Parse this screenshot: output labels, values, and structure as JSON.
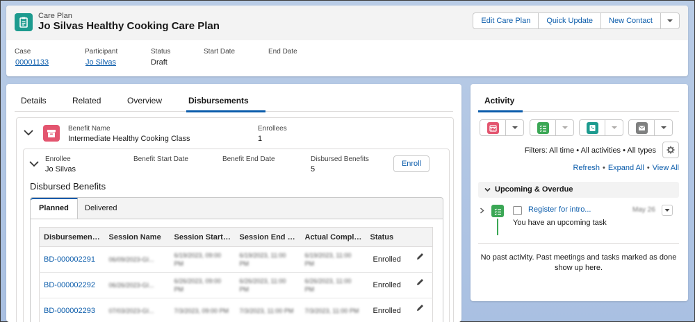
{
  "header": {
    "object_type": "Care Plan",
    "title": "Jo Silvas Healthy Cooking Care Plan",
    "buttons": [
      "Edit Care Plan",
      "Quick Update",
      "New Contact"
    ],
    "fields": [
      {
        "label": "Case",
        "value": "00001133"
      },
      {
        "label": "Participant",
        "value": "Jo Silvas"
      },
      {
        "label": "Status",
        "value": "Draft"
      },
      {
        "label": "Start Date",
        "value": ""
      },
      {
        "label": "End Date",
        "value": ""
      }
    ]
  },
  "main": {
    "tabs": [
      "Details",
      "Related",
      "Overview",
      "Disbursements"
    ],
    "active_tab": "Disbursements",
    "benefit": {
      "name_label": "Benefit Name",
      "name": "Intermediate Healthy Cooking Class",
      "enrollees_label": "Enrollees",
      "enrollees": "1"
    },
    "enrollee": {
      "enrollee_label": "Enrollee",
      "enrollee": "Jo Silvas",
      "start_label": "Benefit Start Date",
      "end_label": "Benefit End Date",
      "disbursed_label": "Disbursed Benefits",
      "disbursed": "5",
      "enroll_button": "Enroll"
    },
    "section_title": "Disbursed Benefits",
    "inner_tabs": [
      "Planned",
      "Delivered"
    ],
    "table": {
      "columns": [
        "Disbursement ...",
        "Session Name",
        "Session Start ...",
        "Session End Ti...",
        "Actual Comple...",
        "Status"
      ],
      "rows": [
        {
          "id": "BD-000002291",
          "session": "06/09/2023-GI...",
          "start": "6/19/2023, 09:00 PM",
          "end": "6/19/2023, 11:00 PM",
          "actual": "6/19/2023, 11:00 PM",
          "status": "Enrolled"
        },
        {
          "id": "BD-000002292",
          "session": "06/26/2023-GI...",
          "start": "6/26/2023, 09:00 PM",
          "end": "6/26/2023, 11:00 PM",
          "actual": "6/26/2023, 11:00 PM",
          "status": "Enrolled"
        },
        {
          "id": "BD-000002293",
          "session": "07/03/2023-GI...",
          "start": "7/3/2023, 09:00 PM",
          "end": "7/3/2023, 11:00 PM",
          "actual": "7/3/2023, 11:00 PM",
          "status": "Enrolled"
        }
      ]
    }
  },
  "activity": {
    "tab": "Activity",
    "quick_actions": [
      "calendar-icon",
      "task-icon",
      "log-call-icon",
      "email-icon"
    ],
    "filters": "Filters: All time • All activities • All types",
    "links": [
      "Refresh",
      "Expand All",
      "View All"
    ],
    "upcoming_label": "Upcoming & Overdue",
    "task": {
      "title": "Register for intro...",
      "date": "May 26",
      "subtitle": "You have an upcoming task"
    },
    "no_past": "No past activity. Past meetings and tasks marked as done show up here."
  },
  "colors": {
    "brand": "#0b5cab",
    "care_plan_icon": "#1d9b8f",
    "benefit_icon": "#e3556f",
    "task_icon": "#3ba755",
    "event_icon": "#e3556f",
    "call_icon": "#1d9b8f",
    "email_icon": "#7f8080"
  }
}
